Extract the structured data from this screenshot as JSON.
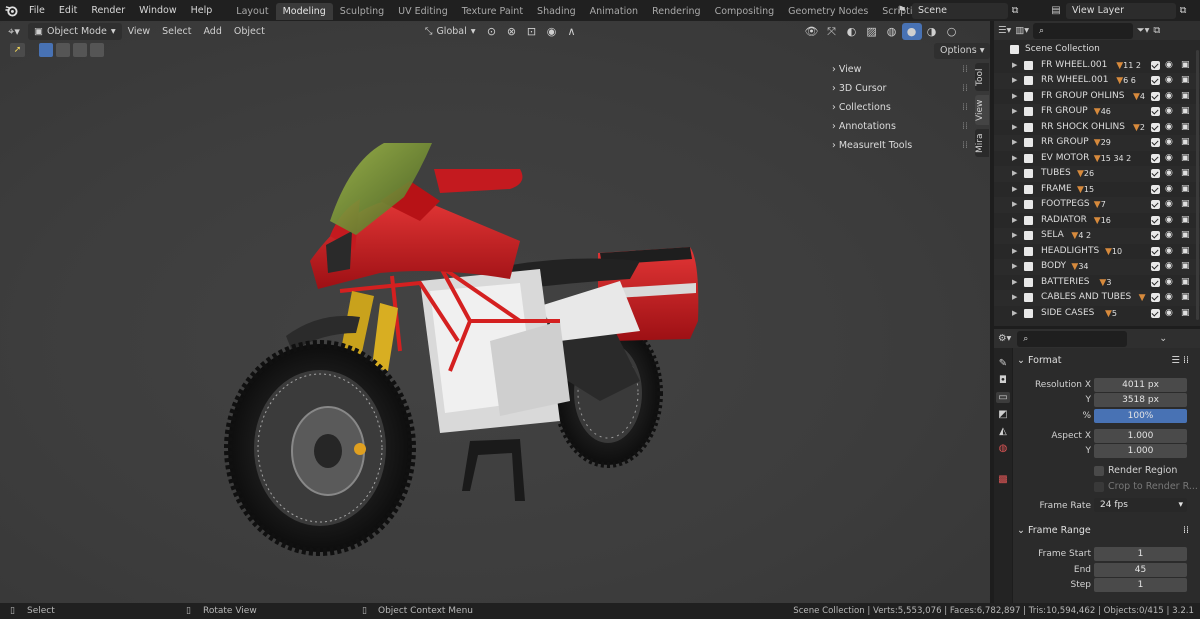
{
  "topbar": {
    "menus": [
      "File",
      "Edit",
      "Render",
      "Window",
      "Help"
    ],
    "workspaces": [
      "Layout",
      "Modeling",
      "Sculpting",
      "UV Editing",
      "Texture Paint",
      "Shading",
      "Animation",
      "Rendering",
      "Compositing",
      "Geometry Nodes",
      "Scripting"
    ],
    "active_workspace": "Modeling",
    "add_tab": "+",
    "scene": "Scene",
    "view_layer": "View Layer"
  },
  "viewport_header": {
    "mode": "Object Mode",
    "menus": [
      "View",
      "Select",
      "Add",
      "Object"
    ],
    "transform_orientation": "Global",
    "options": "Options"
  },
  "n_panel": {
    "items": [
      "View",
      "3D Cursor",
      "Collections",
      "Annotations",
      "MeasureIt Tools"
    ],
    "tabs": [
      "Tool",
      "View",
      "Mira"
    ],
    "active_tab": "View"
  },
  "outliner": {
    "root": "Scene Collection",
    "collections": [
      {
        "name": "FR WHEEL.001",
        "badges": "11 2"
      },
      {
        "name": "RR WHEEL.001",
        "badges": "6 6"
      },
      {
        "name": "FR GROUP OHLINS",
        "badges": "4"
      },
      {
        "name": "FR GROUP",
        "badges": "46"
      },
      {
        "name": "RR SHOCK OHLINS",
        "badges": "2"
      },
      {
        "name": "RR GROUP",
        "badges": "29"
      },
      {
        "name": "EV MOTOR",
        "badges": "15 34 2"
      },
      {
        "name": "TUBES",
        "badges": "26"
      },
      {
        "name": "FRAME",
        "badges": "15"
      },
      {
        "name": "FOOTPEGS",
        "badges": "7"
      },
      {
        "name": "RADIATOR",
        "badges": "16"
      },
      {
        "name": "SELA",
        "badges": "4 2"
      },
      {
        "name": "HEADLIGHTS",
        "badges": "10"
      },
      {
        "name": "BODY",
        "badges": "34"
      },
      {
        "name": "BATTERIES",
        "badges": "3"
      },
      {
        "name": "CABLES AND TUBES",
        "badges": ""
      },
      {
        "name": "SIDE CASES",
        "badges": "5"
      }
    ]
  },
  "properties": {
    "format_label": "Format",
    "resolution_x_label": "Resolution X",
    "resolution_x": "4011 px",
    "resolution_y_label": "Y",
    "resolution_y": "3518 px",
    "percent_label": "%",
    "percent": "100%",
    "aspect_x_label": "Aspect X",
    "aspect_x": "1.000",
    "aspect_y_label": "Y",
    "aspect_y": "1.000",
    "render_region": "Render Region",
    "crop_region": "Crop to Render R...",
    "frame_rate_label": "Frame Rate",
    "frame_rate": "24 fps",
    "frame_range_label": "Frame Range",
    "frame_start_label": "Frame Start",
    "frame_start": "1",
    "frame_end_label": "End",
    "frame_end": "45",
    "frame_step_label": "Step",
    "frame_step": "1"
  },
  "statusbar": {
    "select": "Select",
    "rotate": "Rotate View",
    "context": "Object Context Menu",
    "stats": "Scene Collection | Verts:5,553,076 | Faces:6,782,897 | Tris:10,594,462 | Objects:0/415 | 3.2.1"
  },
  "colors": {
    "accent_blue": "#4872b4",
    "body_red": "#c8181c",
    "frame_red": "#d42020",
    "shock_gold": "#c9a21c",
    "windshield_green": "#7c9a2a"
  }
}
